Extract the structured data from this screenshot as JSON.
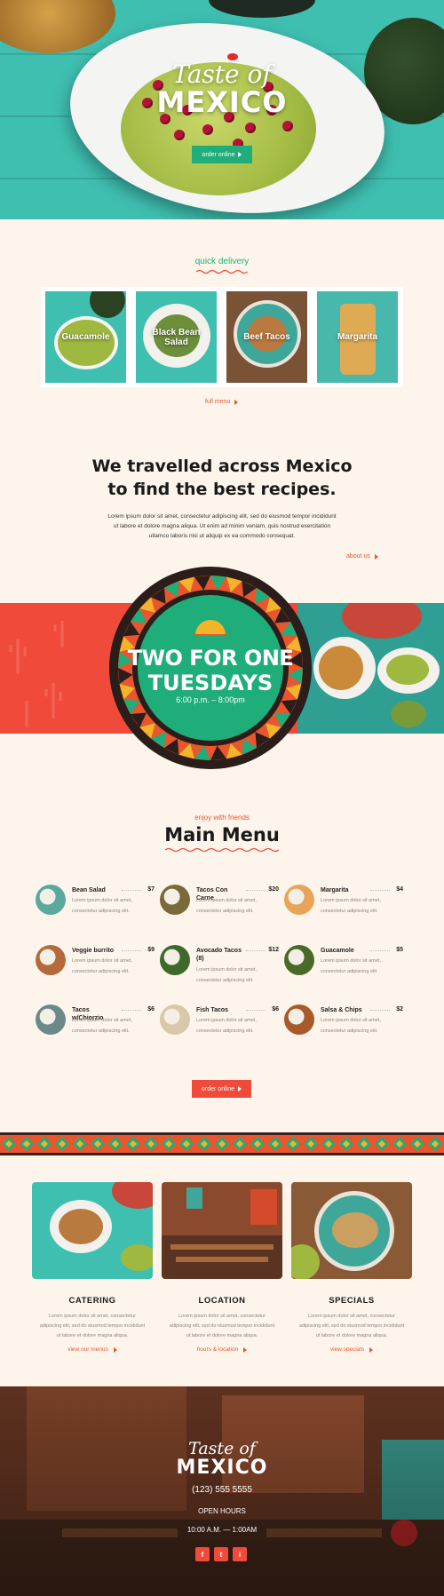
{
  "hero": {
    "logo_script": "Taste of",
    "logo_title": "MEXICO",
    "order_button": "order online"
  },
  "quick_delivery": {
    "heading": "quick delivery",
    "items": [
      {
        "label": "Guacamole"
      },
      {
        "label": "Black Bean Salad"
      },
      {
        "label": "Beef Tacos"
      },
      {
        "label": "Margarita"
      }
    ],
    "full_menu_link": "full menu"
  },
  "about": {
    "title_line1": "We travelled across Mexico",
    "title_line2": "to find the best recipes.",
    "text": "Lorem ipsum dolor sit amet, consectetur adipiscing elit, sed do eiusmod tempor incididunt ut labore et dolore magna aliqua. Ut enim ad minim veniam, quis nostrud exercitation ullamco laboris nisi ut aliquip ex ea commodo consequat.",
    "link": "about us"
  },
  "promo": {
    "line1": "TWO FOR ONE",
    "line2": "TUESDAYS",
    "time": "6:00 p.m. – 8:00pm"
  },
  "menu": {
    "kicker": "enjoy with friends",
    "title": "Main Menu",
    "items": [
      {
        "name": "Bean Salad",
        "price": "$7",
        "desc1": "Lorem ipsum dolor sit amet,",
        "desc2": "consectetur adipiscing elit."
      },
      {
        "name": "Tacos Con Carne",
        "price": "$20",
        "desc1": "Lorem ipsum dolor sit amet,",
        "desc2": "consectetur adipiscing elit."
      },
      {
        "name": "Margarita",
        "price": "$4",
        "desc1": "Lorem ipsum dolor sit amet,",
        "desc2": "consectetur adipiscing elit."
      },
      {
        "name": "Veggie burrito",
        "price": "$9",
        "desc1": "Lorem ipsum dolor sit amet,",
        "desc2": "consectetur adipiscing elit."
      },
      {
        "name": "Avocado Tacos (8)",
        "price": "$12",
        "desc1": "Lorem ipsum dolor sit amet,",
        "desc2": "consectetur adipiscing elit."
      },
      {
        "name": "Guacamole",
        "price": "$5",
        "desc1": "Lorem ipsum dolor sit amet,",
        "desc2": "consectetur adipiscing elit."
      },
      {
        "name": "Tacos w/Chiorzio",
        "price": "$6",
        "desc1": "Lorem ipsum dolor sit amet,",
        "desc2": "consectetur adipiscing elit."
      },
      {
        "name": "Fish Tacos",
        "price": "$6",
        "desc1": "Lorem ipsum dolor sit amet,",
        "desc2": "consectetur adipiscing elit."
      },
      {
        "name": "Salsa & Chips",
        "price": "$2",
        "desc1": "Lorem ipsum dolor sit amet,",
        "desc2": "consectetur adipiscing elit."
      }
    ],
    "order_button": "order online"
  },
  "features": [
    {
      "title": "CATERING",
      "text1": "Lorem ipsum dolor sit amet, consectetur",
      "text2": "adipiscing elit, sed do eiusmod tempor incididunt",
      "text3": "ut labore et dolore magna aliqua.",
      "link": "view our menus"
    },
    {
      "title": "LOCATION",
      "text1": "Lorem ipsum dolor sit amet, consectetur",
      "text2": "adipiscing elit, sed do eiusmod tempor incididunt",
      "text3": "ut labore et dolore magna aliqua.",
      "link": "hours & location"
    },
    {
      "title": "SPECIALS",
      "text1": "Lorem ipsum dolor sit amet, consectetur",
      "text2": "adipiscing elit, sed do eiusmod tempor incididunt",
      "text3": "ut labore et dolore magna aliqua.",
      "link": "view specials"
    }
  ],
  "footer": {
    "logo_script": "Taste of",
    "logo_title": "MEXICO",
    "phone": "(123) 555 5555",
    "hours_label": "OPEN HOURS",
    "hours": "10:00 A.M. — 1:00AM",
    "social": [
      "f",
      "t",
      "i"
    ]
  },
  "colors": {
    "accent_green": "#1fae7a",
    "accent_red": "#f04b3a",
    "accent_orange": "#e8552e",
    "background": "#fdf5ec"
  }
}
